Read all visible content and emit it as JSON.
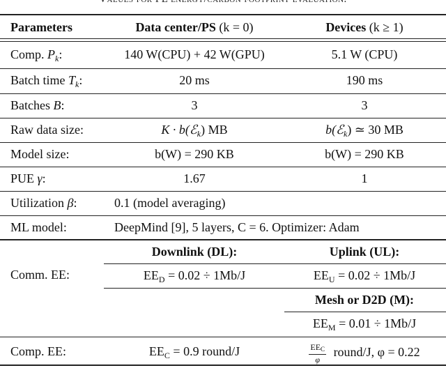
{
  "caption": "Values for FL energy/carbon footprint evaluation.",
  "header": {
    "col1": "Parameters",
    "col2": "Data center/PS",
    "col2_cond": "(k = 0)",
    "col3": "Devices",
    "col3_cond": "(k ≥ 1)"
  },
  "rows": [
    {
      "param": "Comp. ",
      "param_sym": "P",
      "param_sub": "k",
      "param_tail": ":",
      "dc": "140 W(CPU) + 42 W(GPU)",
      "dev": "5.1 W  (CPU)"
    },
    {
      "param": "Batch time ",
      "param_sym": "T",
      "param_sub": "k",
      "param_tail": ":",
      "dc": "20  ms",
      "dev": "190  ms"
    },
    {
      "param": "Batches ",
      "param_sym": "B",
      "param_sub": "",
      "param_tail": ":",
      "dc": "3",
      "dev": "3"
    },
    {
      "param": "Raw data size:",
      "param_sym": "",
      "param_sub": "",
      "param_tail": "",
      "dc": "K · b(ℰ",
      "dc_sub": "k",
      "dc_tail": ")  MB",
      "dev": "b(ℰ",
      "dev_sub": "k",
      "dev_tail": ") ≃ 30  MB"
    },
    {
      "param": "Model size:",
      "param_sym": "",
      "param_sub": "",
      "param_tail": "",
      "dc": "b(W) = 290  KB",
      "dev": "b(W) = 290  KB"
    },
    {
      "param": "PUE ",
      "param_sym": "γ",
      "param_sub": "",
      "param_tail": ":",
      "dc": "1.67",
      "dev": "1"
    }
  ],
  "utilization": {
    "param": "Utilization ",
    "param_sym": "β",
    "param_tail": ":",
    "value": "0.1  (model averaging)"
  },
  "ml_model": {
    "param": "ML model:",
    "value": "DeepMind [9], 5 layers, C = 6. Optimizer: Adam"
  },
  "comm_ee": {
    "param": "Comm.  EE:",
    "downlink_header": "Downlink (DL):",
    "downlink_value_pre": "EE",
    "downlink_value_sub": "D",
    "downlink_value_post": " = 0.02 ÷ 1Mb/J",
    "uplink_header": "Uplink (UL):",
    "uplink_value_pre": "EE",
    "uplink_value_sub": "U",
    "uplink_value_post": " = 0.02 ÷ 1Mb/J",
    "mesh_header": "Mesh or D2D (M):",
    "mesh_value_pre": "EE",
    "mesh_value_sub": "M",
    "mesh_value_post": " = 0.01 ÷ 1Mb/J"
  },
  "comp_ee": {
    "param": "Comp.  EE:",
    "dc_pre": "EE",
    "dc_sub": "C",
    "dc_post": " = 0.9  round/J",
    "dev_frac_num": "EE",
    "dev_frac_num_sub": "C",
    "dev_frac_den": "φ",
    "dev_post": " round/J, φ = 0.22"
  }
}
